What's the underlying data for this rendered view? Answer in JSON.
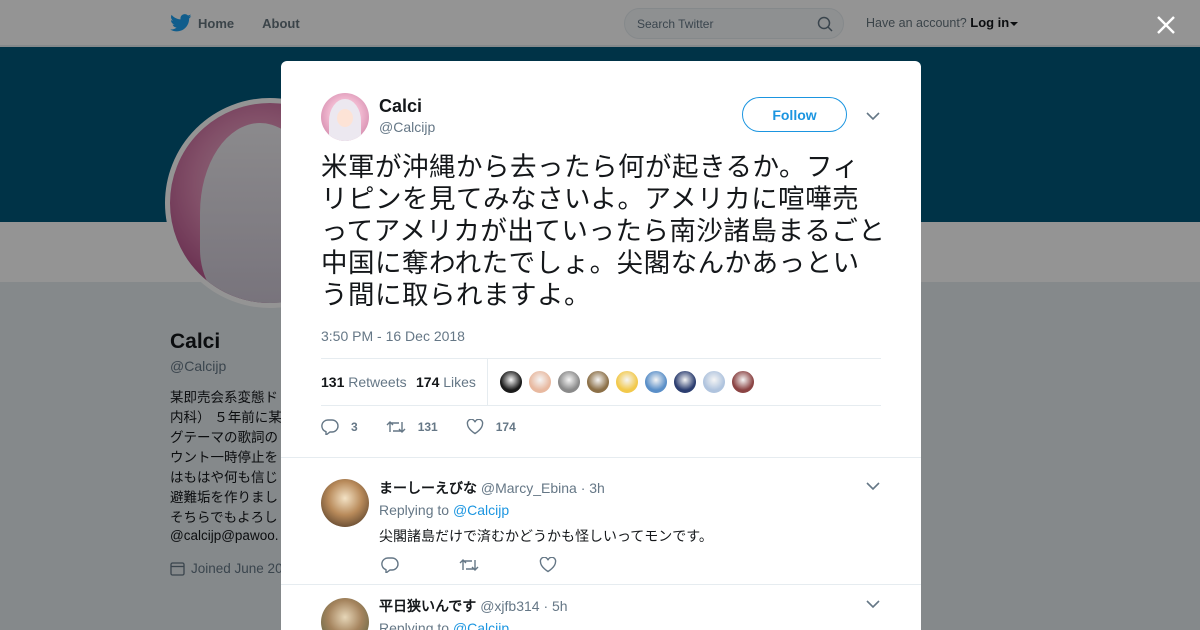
{
  "topbar": {
    "home_label": "Home",
    "about_label": "About",
    "search_placeholder": "Search Twitter",
    "have_account": "Have an account?",
    "login_label": "Log in"
  },
  "background_profile": {
    "name": "Calci",
    "handle": "@Calcijp",
    "bio_lines": [
      "某即売会系変態ド",
      "内科） ５年前に某",
      "グテーマの歌詞の",
      "ウント一時停止を",
      "はもはや何も信じ",
      "避難垢を作りまし",
      "そちらでもよろし"
    ],
    "link": "@calcijp@pawoo.",
    "joined": "Joined June 20"
  },
  "tweet": {
    "author_name": "Calci",
    "author_handle": "@Calcijp",
    "follow_label": "Follow",
    "text": "米軍が沖縄から去ったら何が起きるか。フィリピンを見てみなさいよ。アメリカに喧嘩売ってアメリカが出ていったら南沙諸島まるごと中国に奪われたでしょ。尖閣なんかあっという間に取られますよ。",
    "timestamp": "3:50 PM - 16 Dec 2018",
    "retweets_count": "131",
    "retweets_label": "Retweets",
    "likes_count": "174",
    "likes_label": "Likes",
    "action_reply_count": "3",
    "action_retweet_count": "131",
    "action_like_count": "174",
    "liker_colors": [
      "#1a1a1a",
      "#e8b9a0",
      "#8a8a8a",
      "#8c7048",
      "#f2c94c",
      "#5a8fc8",
      "#2c3e70",
      "#b0c4de",
      "#8b4444"
    ]
  },
  "replies": [
    {
      "name": "まーしーえびな",
      "handle": "@Marcy_Ebina",
      "time": "· 3h",
      "replying_to_label": "Replying to",
      "replying_to_handle": "@Calcijp",
      "text": "尖閣諸島だけで済むかどうかも怪しいってモンです。"
    },
    {
      "name": "平日狭いんです",
      "handle": "@xjfb314",
      "time": "· 5h",
      "replying_to_label": "Replying to",
      "replying_to_handle": "@Calcijp",
      "text": ""
    }
  ]
}
